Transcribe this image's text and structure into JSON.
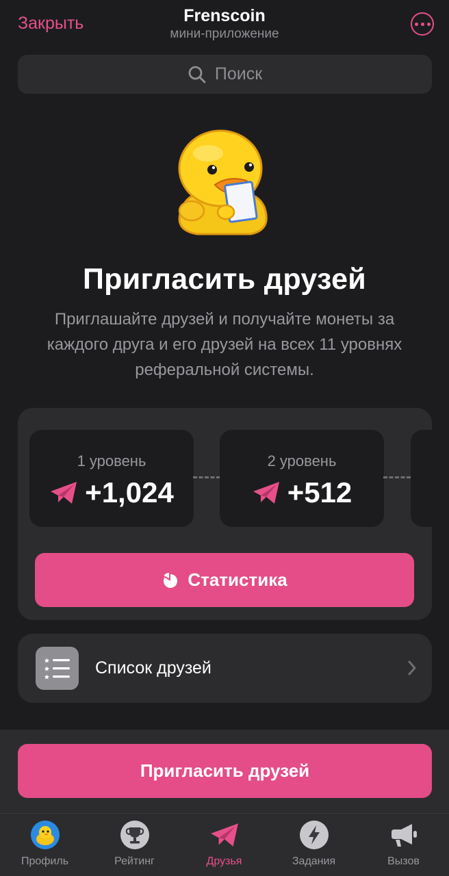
{
  "header": {
    "close_label": "Закрыть",
    "title": "Frenscoin",
    "subtitle": "мини-приложение"
  },
  "search": {
    "placeholder": "Поиск"
  },
  "hero": {
    "title": "Пригласить друзей",
    "description": "Приглашайте друзей и получайте монеты за каждого друга и его друзей на всех 11 уровнях реферальной системы."
  },
  "levels": [
    {
      "name": "1 уровень",
      "value": "+1,024"
    },
    {
      "name": "2 уровень",
      "value": "+512"
    }
  ],
  "stats_button": {
    "label": "Статистика"
  },
  "friends_list": {
    "label": "Список друзей"
  },
  "invite_button": {
    "label": "Пригласить друзей"
  },
  "tabs": [
    {
      "label": "Профиль",
      "icon": "duck-avatar-icon",
      "active": false
    },
    {
      "label": "Рейтинг",
      "icon": "trophy-icon",
      "active": false
    },
    {
      "label": "Друзья",
      "icon": "paper-plane-icon",
      "active": true
    },
    {
      "label": "Задания",
      "icon": "lightning-icon",
      "active": false
    },
    {
      "label": "Вызов",
      "icon": "megaphone-icon",
      "active": false
    }
  ],
  "colors": {
    "accent": "#e44d87",
    "background": "#1c1c1e",
    "card": "#2c2c2e",
    "muted_text": "#98989d"
  }
}
